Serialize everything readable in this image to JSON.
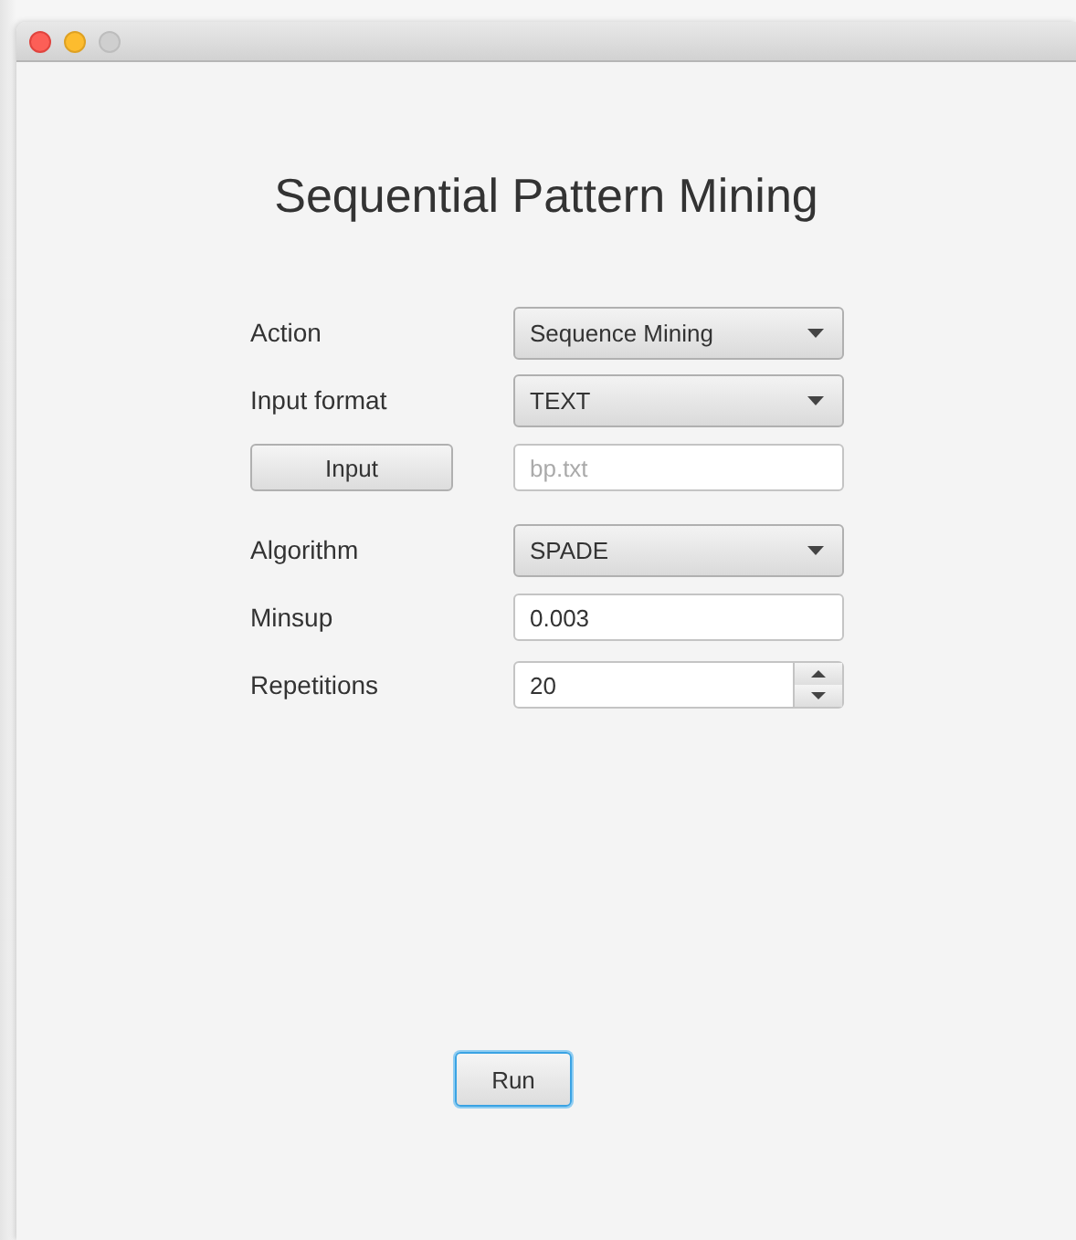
{
  "title": "Sequential Pattern Mining",
  "form": [
    {
      "kind": "combo",
      "label": "Action",
      "value": "Sequence Mining"
    },
    {
      "kind": "combo",
      "label": "Input format",
      "value": "TEXT"
    },
    {
      "kind": "file",
      "button": "Input",
      "placeholder": "bp.txt"
    },
    {
      "kind": "combo",
      "label": "Algorithm",
      "value": "SPADE"
    },
    {
      "kind": "field",
      "label": "Minsup",
      "value": "0.003"
    },
    {
      "kind": "spinner",
      "label": "Repetitions",
      "value": "20"
    }
  ],
  "run_button": {
    "label": "Run",
    "focused": true
  }
}
